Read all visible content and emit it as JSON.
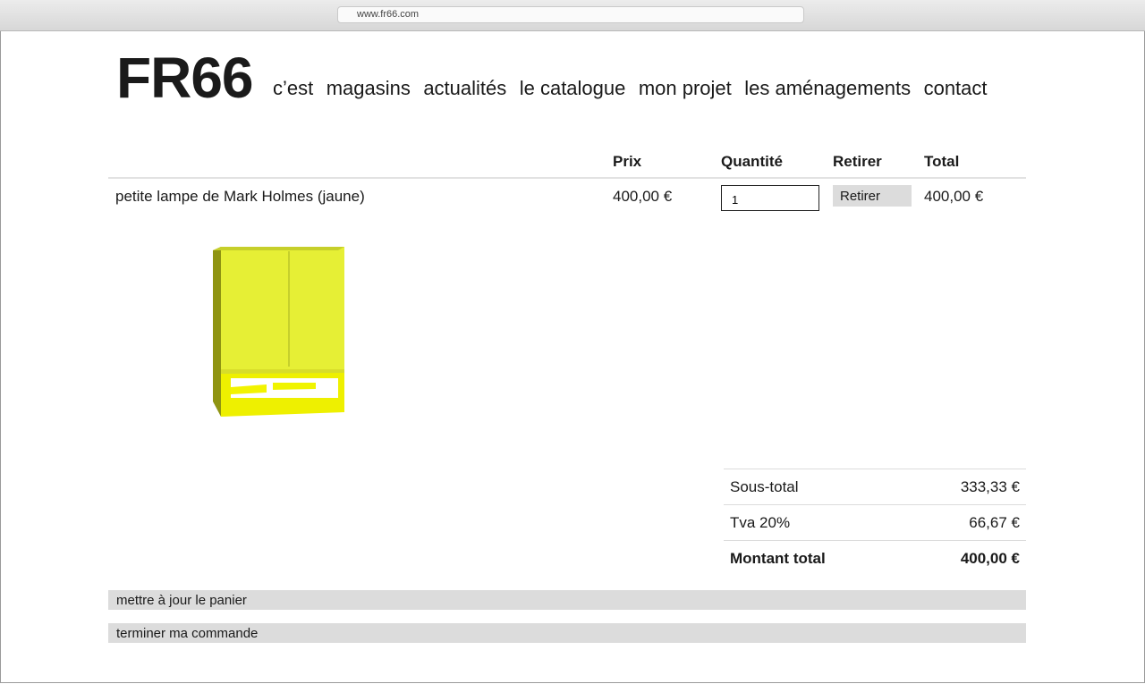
{
  "browser": {
    "url": "www.fr66.com"
  },
  "site": {
    "logo": "FR66",
    "nav": [
      "c’est",
      "magasins",
      "actualités",
      "le catalogue",
      "mon projet",
      "les aménagements",
      "contact"
    ]
  },
  "cart": {
    "headers": {
      "price": "Prix",
      "quantity": "Quantité",
      "remove": "Retirer",
      "total": "Total"
    },
    "item": {
      "name": "petite lampe de Mark Holmes (jaune)",
      "price": "400,00 €",
      "quantity": "1",
      "remove_label": "Retirer",
      "total": "400,00 €",
      "image_icon": "yellow-lamp-icon",
      "color": "#e8ef2a"
    },
    "summary": {
      "subtotal_label": "Sous-total",
      "subtotal": "333,33 €",
      "tax_label": "Tva 20%",
      "tax": "66,67 €",
      "total_label": "Montant total",
      "total": "400,00 €"
    },
    "update_label": "mettre à jour le panier",
    "checkout_label": "terminer ma commande"
  }
}
